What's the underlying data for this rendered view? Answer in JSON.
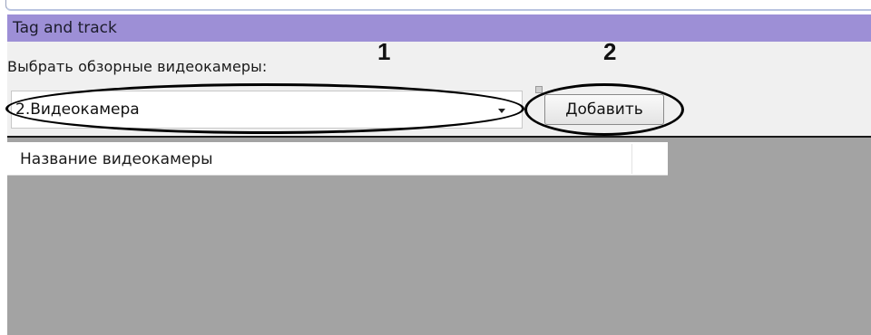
{
  "window": {
    "title": "Tag and track"
  },
  "form": {
    "select_label": "Выбрать обзорные видеокамеры:",
    "selected_camera": "2.Видеокамера",
    "add_button_label": "Добавить"
  },
  "annotations": {
    "marker_1": "1",
    "marker_2": "2"
  },
  "table": {
    "columns": [
      "Название видеокамеры"
    ]
  },
  "colors": {
    "header_bg": "#9d8fd6",
    "grid_bg": "#a3a3a3",
    "panel_bg": "#f0f0f0"
  }
}
